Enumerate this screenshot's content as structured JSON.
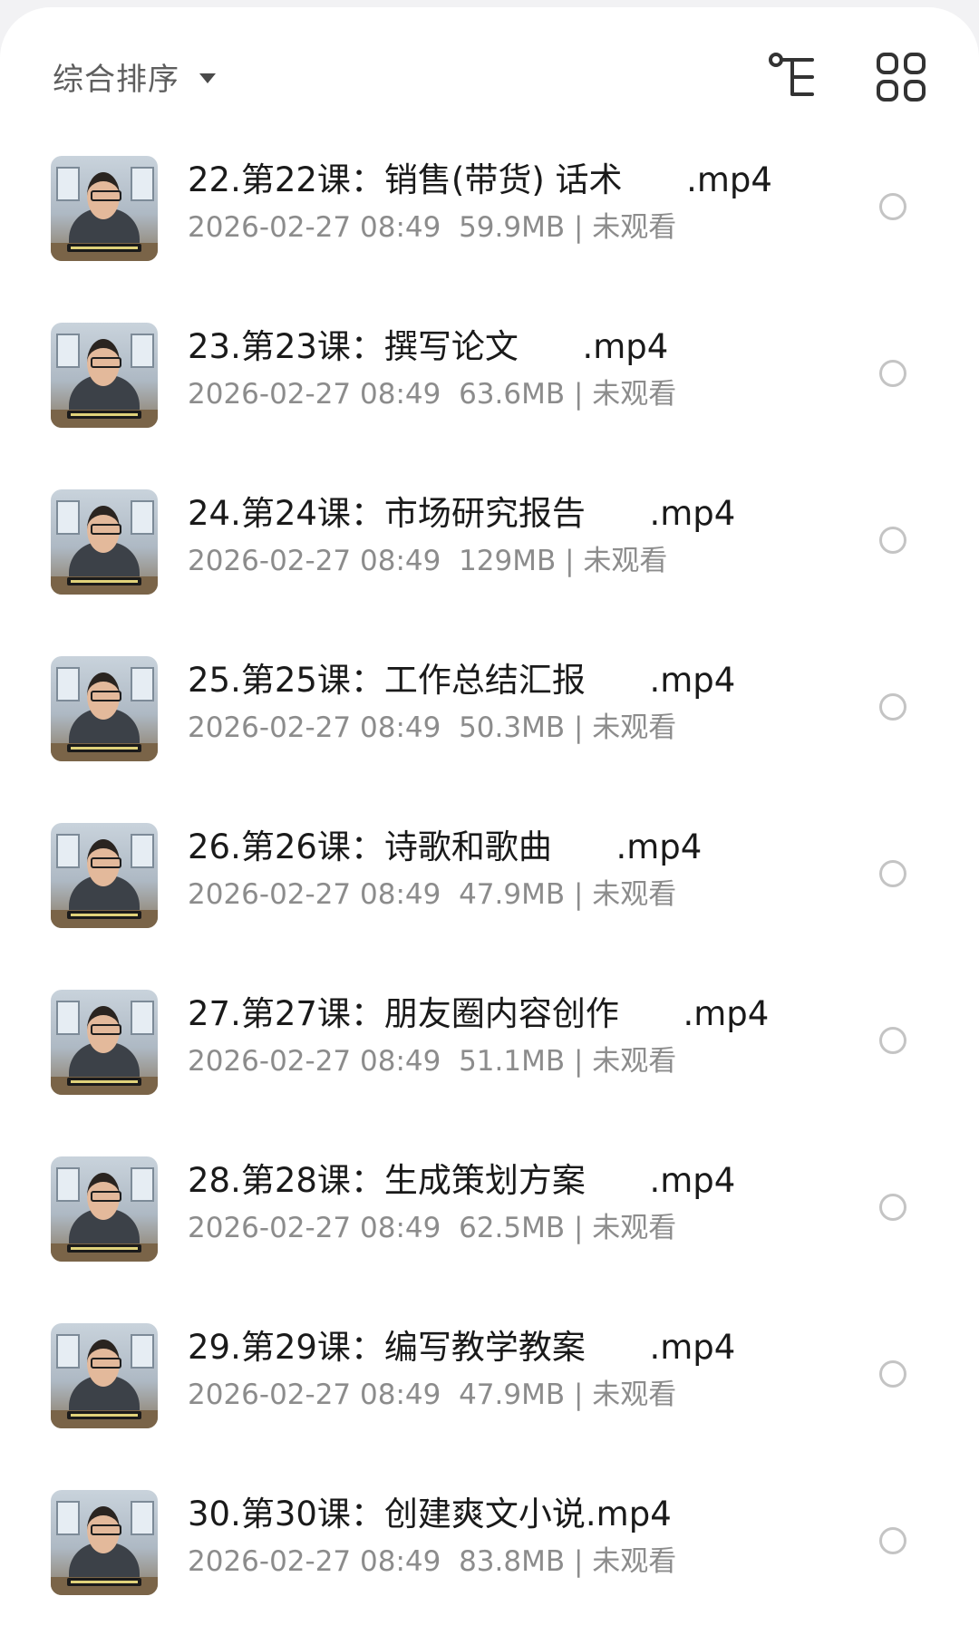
{
  "toolbar": {
    "sort_label": "综合排序",
    "sort_caret_icon": "caret-down-icon",
    "tree_icon": "tree-view-icon",
    "grid_icon": "grid-view-icon"
  },
  "files": [
    {
      "title": "22.第22课：销售(带货) 话术      .mp4",
      "date": "2026-02-27 08:49",
      "size": "59.9MB",
      "status": "未观看"
    },
    {
      "title": "23.第23课：撰写论文      .mp4",
      "date": "2026-02-27 08:49",
      "size": "63.6MB",
      "status": "未观看"
    },
    {
      "title": "24.第24课：市场研究报告      .mp4",
      "date": "2026-02-27 08:49",
      "size": "129MB",
      "status": "未观看"
    },
    {
      "title": "25.第25课：工作总结汇报      .mp4",
      "date": "2026-02-27 08:49",
      "size": "50.3MB",
      "status": "未观看"
    },
    {
      "title": "26.第26课：诗歌和歌曲      .mp4",
      "date": "2026-02-27 08:49",
      "size": "47.9MB",
      "status": "未观看"
    },
    {
      "title": "27.第27课：朋友圈内容创作      .mp4",
      "date": "2026-02-27 08:49",
      "size": "51.1MB",
      "status": "未观看"
    },
    {
      "title": "28.第28课：生成策划方案      .mp4",
      "date": "2026-02-27 08:49",
      "size": "62.5MB",
      "status": "未观看"
    },
    {
      "title": "29.第29课：编写教学教案      .mp4",
      "date": "2026-02-27 08:49",
      "size": "47.9MB",
      "status": "未观看"
    },
    {
      "title": "30.第30课：创建爽文小说.mp4",
      "date": "2026-02-27 08:49",
      "size": "83.8MB",
      "status": "未观看"
    }
  ]
}
